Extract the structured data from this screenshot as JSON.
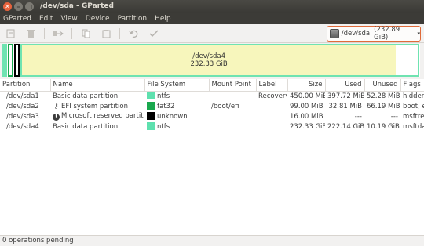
{
  "window": {
    "title": "/dev/sda - GParted"
  },
  "menu": [
    "GParted",
    "Edit",
    "View",
    "Device",
    "Partition",
    "Help"
  ],
  "toolbar": {
    "icons": [
      "new-icon",
      "delete-icon",
      "resize-move-icon",
      "copy-icon",
      "paste-icon",
      "undo-icon",
      "apply-icon"
    ]
  },
  "device_selector": {
    "device": "/dev/sda",
    "size": "(232.89 GiB)"
  },
  "disk_map": {
    "main_partition": "/dev/sda4",
    "main_size": "232.33 GiB",
    "used_fraction": 0.955
  },
  "table": {
    "headers": [
      "Partition",
      "Name",
      "File System",
      "Mount Point",
      "Label",
      "Size",
      "Used",
      "Unused",
      "Flags"
    ],
    "rows": [
      {
        "partition": "/dev/sda1",
        "icon": "",
        "name": "Basic data partition",
        "fs": "ntfs",
        "fs_color": "#5ee0ae",
        "mount": "",
        "label": "Recovery",
        "size": "450.00 MiB",
        "used": "397.72 MiB",
        "unused": "52.28 MiB",
        "flags": "hidden, diag"
      },
      {
        "partition": "/dev/sda2",
        "icon": "key-icon",
        "name": "EFI system partition",
        "fs": "fat32",
        "fs_color": "#1aa84e",
        "mount": "/boot/efi",
        "label": "",
        "size": "99.00 MiB",
        "used": "32.81 MiB",
        "unused": "66.19 MiB",
        "flags": "boot, esp"
      },
      {
        "partition": "/dev/sda3",
        "icon": "warning-icon",
        "name": "Microsoft reserved partition",
        "fs": "unknown",
        "fs_color": "#000000",
        "mount": "",
        "label": "",
        "size": "16.00 MiB",
        "used": "---",
        "unused": "---",
        "flags": "msftres"
      },
      {
        "partition": "/dev/sda4",
        "icon": "",
        "name": "Basic data partition",
        "fs": "ntfs",
        "fs_color": "#5ee0ae",
        "mount": "",
        "label": "",
        "size": "232.33 GiB",
        "used": "222.14 GiB",
        "unused": "10.19 GiB",
        "flags": "msftdata"
      }
    ]
  },
  "status": {
    "text": "0 operations pending"
  },
  "colors": {
    "accent": "#e06b3a",
    "ntfs": "#5ee0ae",
    "fat32": "#1aa84e",
    "used_fill": "#f7f6bc"
  }
}
